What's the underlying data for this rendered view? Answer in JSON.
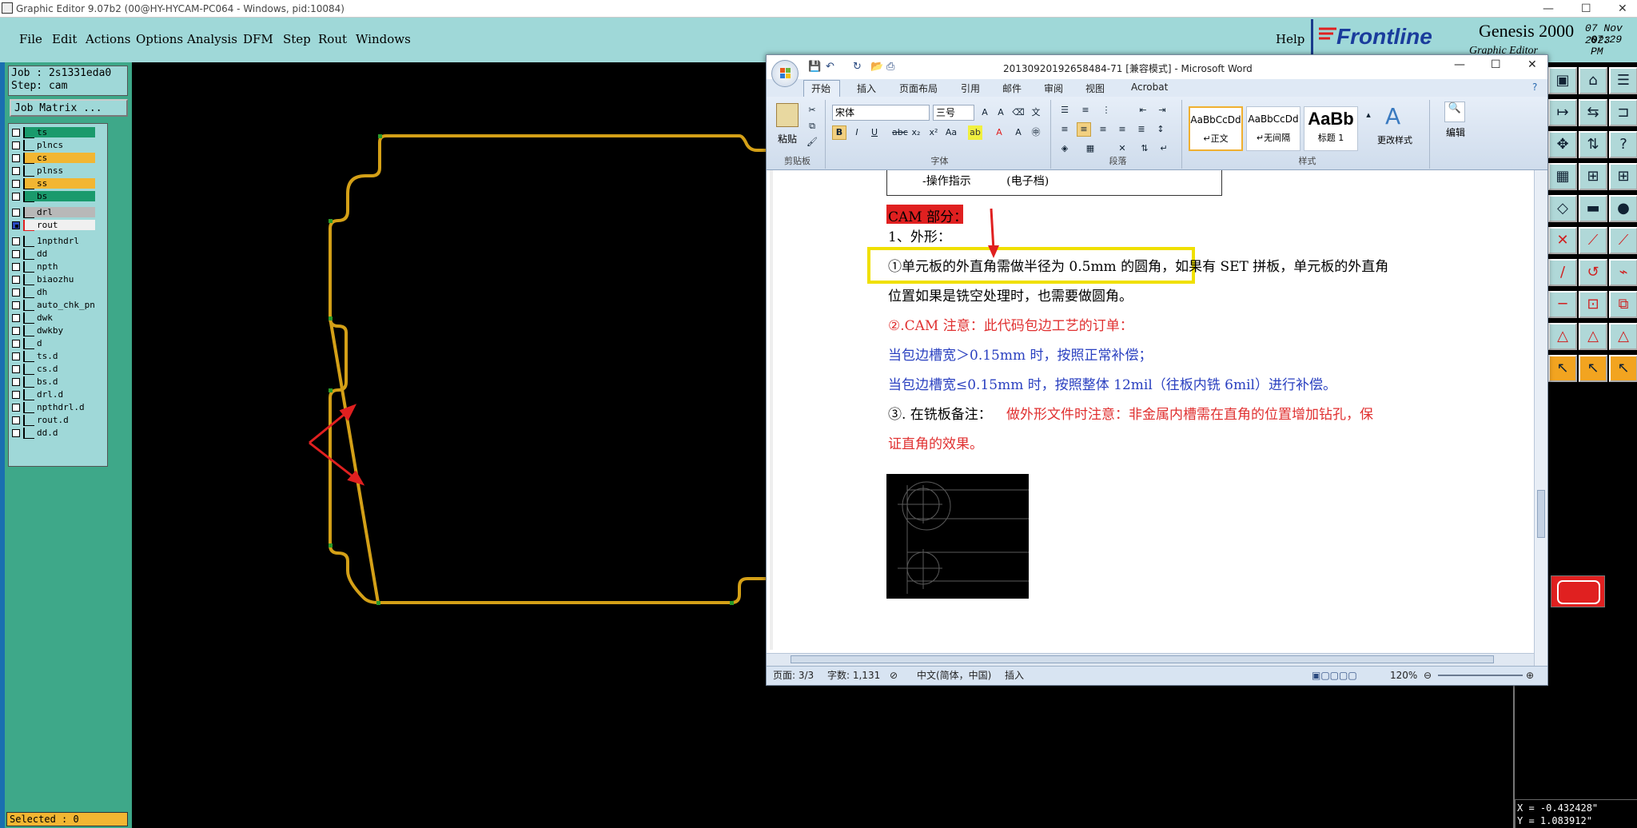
{
  "window": {
    "title": "Graphic Editor 9.07b2 (00@HY-HYCAM-PC064 - Windows, pid:10084)"
  },
  "menu": [
    "File",
    "Edit",
    "Actions",
    "Options",
    "Analysis",
    "DFM",
    "Step",
    "Rout",
    "Windows"
  ],
  "help": "Help",
  "brand": {
    "logo": "Frontline",
    "product": "Genesis 2000",
    "subtitle": "Graphic Editor",
    "date": "07 Nov 2023",
    "time": "07:29 PM"
  },
  "job": {
    "job": "Job : 2s1331eda0",
    "step": "Step: cam",
    "matrix_button": "Job Matrix ..."
  },
  "layers": [
    {
      "name": "ts",
      "color": "#1a9a6c"
    },
    {
      "name": "plncs",
      "color": "#9fd8d8"
    },
    {
      "name": "cs",
      "color": "#f2b632"
    },
    {
      "name": "plnss",
      "color": "#9fd8d8"
    },
    {
      "name": "ss",
      "color": "#f2b632"
    },
    {
      "name": "bs",
      "color": "#1a9a6c"
    },
    {
      "name": "drl",
      "color": "#b8b8b8"
    },
    {
      "name": "rout",
      "color": "#f0f0f0",
      "active": true
    },
    {
      "name": "1npthdrl",
      "color": "#9fd8d8"
    },
    {
      "name": "dd",
      "color": "#9fd8d8"
    },
    {
      "name": "npth",
      "color": "#9fd8d8"
    },
    {
      "name": "biaozhu",
      "color": "#9fd8d8"
    },
    {
      "name": "dh",
      "color": "#9fd8d8"
    },
    {
      "name": "auto_chk_pn",
      "color": "#9fd8d8"
    },
    {
      "name": "dwk",
      "color": "#9fd8d8"
    },
    {
      "name": "dwkby",
      "color": "#9fd8d8"
    },
    {
      "name": "d",
      "color": "#9fd8d8"
    },
    {
      "name": "ts.d",
      "color": "#9fd8d8"
    },
    {
      "name": "cs.d",
      "color": "#9fd8d8"
    },
    {
      "name": "bs.d",
      "color": "#9fd8d8"
    },
    {
      "name": "drl.d",
      "color": "#9fd8d8"
    },
    {
      "name": "npthdrl.d",
      "color": "#9fd8d8"
    },
    {
      "name": "rout.d",
      "color": "#9fd8d8"
    },
    {
      "name": "dd.d",
      "color": "#9fd8d8"
    }
  ],
  "status": {
    "selected": "Selected : 0"
  },
  "coords": {
    "x": "X = -0.432428\"",
    "y": "Y = 1.083912\""
  },
  "word": {
    "title": "20130920192658484-71 [兼容模式] - Microsoft Word",
    "tabs": [
      "开始",
      "插入",
      "页面布局",
      "引用",
      "邮件",
      "审阅",
      "视图",
      "Acrobat"
    ],
    "font_name": "宋体",
    "font_size": "三号",
    "groups": {
      "clipboard": "剪贴板",
      "font": "字体",
      "paragraph": "段落",
      "styles": "样式",
      "paste": "粘贴",
      "change_styles": "更改样式",
      "edit": "编辑"
    },
    "styles": [
      {
        "preview": "AaBbCcDd",
        "name": "↵正文"
      },
      {
        "preview": "AaBbCcDd",
        "name": "↵无间隔"
      },
      {
        "preview": "AaBb",
        "name": "标题 1"
      }
    ],
    "doc": {
      "table_text": "-操作指示          (电子档)",
      "heading": "CAM 部分：",
      "line1": "1、外形：",
      "para1a": "①单元板的外直角需做半径为 0.5mm 的圆角，如果有 SET 拼板，单元板的外直角",
      "para1b": "位置如果是铣空处理时，也需要做圆角。",
      "para2": "②.CAM 注意：此代码包边工艺的订单：",
      "para3": "当包边槽宽＞0.15mm 时，按照正常补偿；",
      "para4": "当包边槽宽≤0.15mm 时，按照整体 12mil（往板内铣 6mil）进行补偿。",
      "para5_prefix": "③. 在铣板备注：",
      "para5_red": "做外形文件时注意：非金属内槽需在直角的位置增加钻孔，保",
      "para6": "证直角的效果。"
    },
    "statusbar": {
      "page": "页面: 3/3",
      "words": "字数: 1,131",
      "lang": "中文(简体，中国)",
      "mode": "插入",
      "zoom": "120%"
    }
  },
  "colors": {
    "menubar": "#9fd8d8",
    "leftpane": "#3ea889",
    "outline": "#d4a017",
    "red": "#e02020",
    "yellowbox": "#f0e000"
  }
}
